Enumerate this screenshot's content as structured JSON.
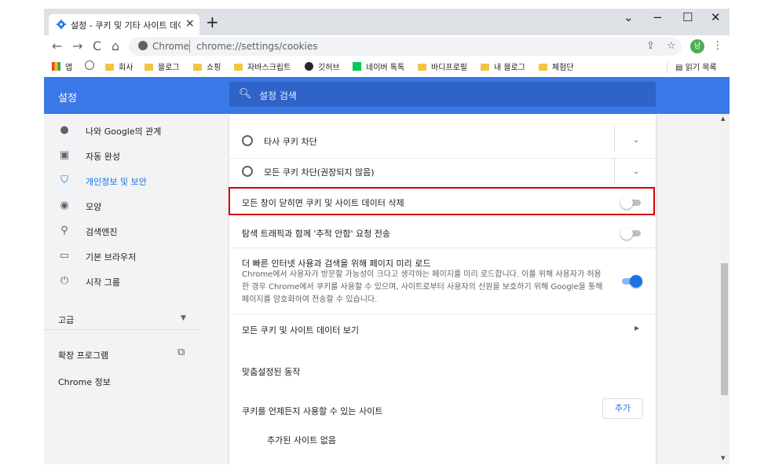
{
  "tab": {
    "title": "설정 - 쿠키 및 기타 사이트 데이",
    "close": "×"
  },
  "newtab": "+",
  "window": {
    "minimize": "−",
    "maximize": "☐",
    "close": "✕",
    "dropdown": "⌄"
  },
  "toolbar": {
    "back": "←",
    "forward": "→",
    "reload": "C",
    "home": "⌂",
    "host": "Chrome",
    "url": "chrome://settings/cookies",
    "share": "⇪",
    "star": "☆",
    "avatar": "남",
    "menu": "⋮"
  },
  "bookmarks": {
    "items": [
      "앱",
      "회사",
      "블로그",
      "쇼핑",
      "자바스크립트",
      "깃허브",
      "네이버 톡톡",
      "바디프로필",
      "내 블로그",
      "체험단"
    ],
    "reading_list": "읽기 목록"
  },
  "header": {
    "title": "설정",
    "search_placeholder": "설정 검색",
    "search_icon": "search-icon"
  },
  "sidebar": {
    "items": [
      {
        "label": "나와 Google의 관계",
        "icon": "person-icon"
      },
      {
        "label": "자동 완성",
        "icon": "clipboard-icon"
      },
      {
        "label": "개인정보 및 보안",
        "icon": "shield-icon"
      },
      {
        "label": "모양",
        "icon": "palette-icon"
      },
      {
        "label": "검색엔진",
        "icon": "search-icon"
      },
      {
        "label": "기본 브라우저",
        "icon": "browser-icon"
      },
      {
        "label": "시작 그룹",
        "icon": "power-icon"
      }
    ],
    "advanced": "고급",
    "extensions": "확장 프로그램",
    "about": "Chrome 정보"
  },
  "main": {
    "block_third_party": "타사 쿠키 차단",
    "block_all": "모든 쿠키 차단(권장되지 않음)",
    "clear_on_exit": "모든 창이 닫히면 쿠키 및 사이트 데이터 삭제",
    "do_not_track": "탐색 트래픽과 함께 '추적 안함' 요청 전송",
    "preload_title": "더 빠른 인터넷 사용과 검색을 위해 페이지 미리 로드",
    "preload_desc": "Chrome에서 사용자가 방문할 가능성이 크다고 생각하는 페이지를 미리 로드합니다. 이를 위해 사용자가 허용한 경우 Chrome에서 쿠키를 사용할 수 있으며, 사이트로부터 사용자의 신원을 보호하기 위해 Google을 통해 페이지를 암호화하여 전송할 수 있습니다.",
    "see_all": "모든 쿠키 및 사이트 데이터 보기",
    "custom_behaviors": "맞춤설정된 동작",
    "always_allow": "쿠키를 언제든지 사용할 수 있는 사이트",
    "add_button": "추가",
    "no_sites": "추가된 사이트 없음"
  },
  "toggles": {
    "clear_on_exit": false,
    "do_not_track": false,
    "preload": true
  },
  "colors": {
    "header": "#3b78e7",
    "accent": "#1a73e8",
    "highlight": "#d00000"
  }
}
